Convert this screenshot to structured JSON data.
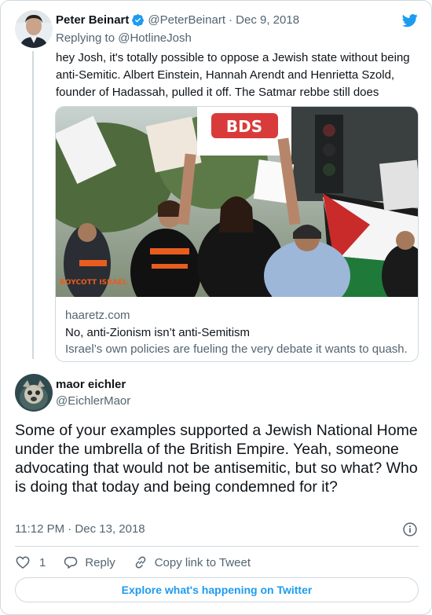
{
  "parent_tweet": {
    "name": "Peter Beinart",
    "handle": "@PeterBeinart",
    "date": "· Dec 9, 2018",
    "replying_to": "Replying to @HotlineJosh",
    "text": "hey Josh, it's totally possible to oppose a Jewish state without being anti-Semitic. Albert Einstein, Hannah Arendt and Henrietta Szold, founder of Hadassah, pulled it off. The Satmar rebbe still does",
    "link_card": {
      "image_sign": "BDS",
      "image_shirt_text": "BOYCOTT ISRAEL",
      "domain": "haaretz.com",
      "title": "No, anti-Zionism isn’t anti-Semitism",
      "description": "Israel’s own policies are fueling the very debate it wants to quash."
    }
  },
  "main_tweet": {
    "name": "maor eichler",
    "handle": "@EichlerMaor",
    "text": "Some of your examples supported a Jewish National Home under the umbrella of the British Empire. Yeah, someone advocating that would not be antisemitic, but so what? Who is doing that today and being condemned for it?",
    "timestamp": "11:12 PM · Dec 13, 2018"
  },
  "actions": {
    "like_count": "1",
    "reply_label": "Reply",
    "copy_link_label": "Copy link to Tweet"
  },
  "explore_label": "Explore what's happening on Twitter",
  "colors": {
    "accent": "#1d9bf0",
    "text_primary": "#0f1419",
    "text_secondary": "#536471",
    "border": "#cfd9de"
  },
  "icons": [
    "twitter-bird-icon",
    "verified-badge-icon",
    "info-icon",
    "heart-icon",
    "reply-icon",
    "link-icon"
  ]
}
